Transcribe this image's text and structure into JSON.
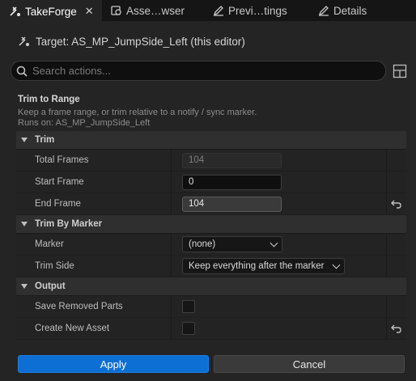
{
  "tabs": [
    {
      "label": "TakeForge",
      "icon": "takeforge-icon",
      "active": true
    },
    {
      "label": "Asse…wser",
      "icon": "asset-browser-icon",
      "active": false
    },
    {
      "label": "Previ…tings",
      "icon": "pencil-icon",
      "active": false
    },
    {
      "label": "Details",
      "icon": "pencil-icon",
      "active": false
    }
  ],
  "target": {
    "label": "Target: AS_MP_JumpSide_Left (this editor)"
  },
  "search": {
    "placeholder": "Search actions..."
  },
  "action": {
    "title": "Trim to Range",
    "description": "Keep a frame range, or trim relative to a notify / sync marker.",
    "runs_on": "Runs on: AS_MP_JumpSide_Left"
  },
  "sections": {
    "trim": {
      "label": "Trim",
      "total_frames_label": "Total Frames",
      "total_frames_value": "104",
      "start_frame_label": "Start Frame",
      "start_frame_value": "0",
      "end_frame_label": "End Frame",
      "end_frame_value": "104"
    },
    "trim_by_marker": {
      "label": "Trim By Marker",
      "marker_label": "Marker",
      "marker_value": "(none)",
      "trim_side_label": "Trim Side",
      "trim_side_value": "Keep everything after the marker"
    },
    "output": {
      "label": "Output",
      "save_removed_label": "Save Removed Parts",
      "save_removed_checked": false,
      "create_new_label": "Create New Asset",
      "create_new_checked": false
    }
  },
  "buttons": {
    "apply": "Apply",
    "cancel": "Cancel"
  },
  "colors": {
    "accent": "#0d6fd4",
    "background": "#242424",
    "tabbar": "#151515"
  }
}
